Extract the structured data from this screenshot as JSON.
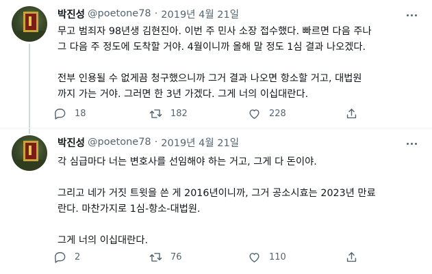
{
  "tweets": [
    {
      "name": "박진성",
      "handle": "@poetone78",
      "separator": "·",
      "date": "2019년 4월 21일",
      "text": "무고 범죄자 98년생 김현진아. 이번 주 민사 소장 접수했다. 빠르면 다음 주나\n그 다음 주 정도에 도착할 거야. 4월이니까 올해 말 정도 1심 결과 나오겠다.\n\n전부 인용될 수 없게끔 청구했으니까 그거 결과 나오면 항소할 거고, 대법원\n까지 가는 거야. 그러면 한 3년 가겠다. 그게 너의 이십대란다.",
      "replies": "18",
      "retweets": "182",
      "likes": "228"
    },
    {
      "name": "박진성",
      "handle": "@poetone78",
      "separator": "·",
      "date": "2019년 4월 21일",
      "text": "각 심급마다 너는 변호사를 선임해야 하는 거고, 그게 다 돈이야.\n\n그리고 네가 거짓 트윗을 쓴 게 2016년이니까, 그거 공소시효는 2023년 만료\n란다. 마찬가지로 1심-항소-대법원.\n\n그게 너의 이십대란다.",
      "replies": "2",
      "retweets": "76",
      "likes": "110"
    }
  ],
  "icons": {
    "reply": "reply-icon",
    "retweet": "retweet-icon",
    "like": "heart-icon",
    "share": "share-icon",
    "more": "more-icon"
  },
  "colors": {
    "text": "#0f1419",
    "secondary": "#536471",
    "divider": "#eff3f4",
    "thread_line": "#cfd9de"
  }
}
